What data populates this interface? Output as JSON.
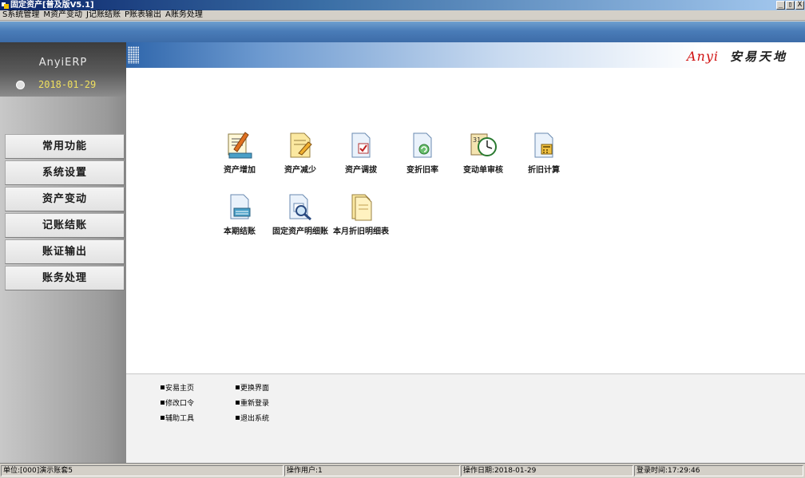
{
  "window": {
    "title": "固定资产[普及版V5.1]",
    "buttons": [
      "_",
      "▯",
      "X"
    ]
  },
  "menubar": [
    {
      "label": "S系统管理"
    },
    {
      "label": "M资产变动"
    },
    {
      "label": "J记账结账"
    },
    {
      "label": "P账表输出"
    },
    {
      "label": "A账务处理"
    }
  ],
  "sidebar": {
    "brand": "AnyiERP",
    "date": "2018-01-29",
    "nav": [
      "常用功能",
      "系统设置",
      "资产变动",
      "记账结账",
      "账证输出",
      "账务处理"
    ]
  },
  "banner": {
    "logo_en": "Anyi",
    "logo_cn": "安易天地"
  },
  "functions": [
    {
      "label": "资产增加",
      "icon": "asset-add-icon"
    },
    {
      "label": "资产减少",
      "icon": "asset-reduce-icon"
    },
    {
      "label": "资产调拔",
      "icon": "asset-transfer-icon"
    },
    {
      "label": "变折旧率",
      "icon": "depreciation-rate-icon"
    },
    {
      "label": "变动单审核",
      "icon": "change-review-icon"
    },
    {
      "label": "折旧计算",
      "icon": "depreciation-calc-icon"
    },
    {
      "label": "本期结账",
      "icon": "period-close-icon"
    },
    {
      "label": "固定资产明细账",
      "icon": "asset-ledger-icon"
    },
    {
      "label": "本月折旧明细表",
      "icon": "monthly-depreciation-icon"
    }
  ],
  "quick_links": [
    "安易主页",
    "更换界面",
    "修改口令",
    "重新登录",
    "辅助工具",
    "退出系统"
  ],
  "status": {
    "unit": "单位:[000]演示账套5",
    "operator": "操作用户:1",
    "op_date": "操作日期:2018-01-29",
    "login_time": "登录时间:17:29:46"
  },
  "colors": {
    "accent_red": "#d01010",
    "date_yellow": "#f0e060",
    "banner_blue": "#2f66ab"
  }
}
